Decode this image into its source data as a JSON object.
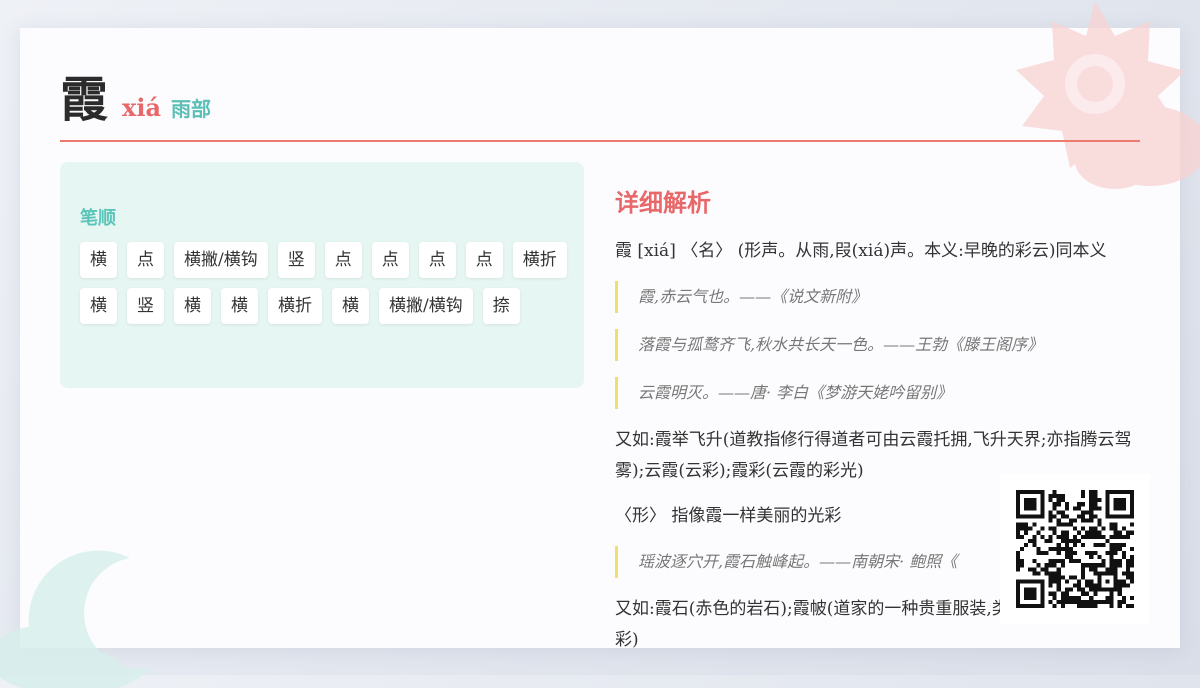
{
  "header": {
    "character": "霞",
    "pinyin": "xiá",
    "radical": "雨部"
  },
  "stroke_order": {
    "title": "笔顺",
    "strokes": [
      "横",
      "点",
      "横撇/横钩",
      "竖",
      "点",
      "点",
      "点",
      "点",
      "横折",
      "横",
      "竖",
      "横",
      "横",
      "横折",
      "横",
      "横撇/横钩",
      "捺"
    ]
  },
  "detail": {
    "title": "详细解析",
    "definition_1": "霞 [xiá] 〈名〉 (形声。从雨,叚(xiá)声。本义:早晚的彩云)同本义",
    "quotes_1": [
      "霞,赤云气也。——《说文新附》",
      "落霞与孤鹜齐飞,秋水共长天一色。——王勃《滕王阁序》",
      "云霞明灭。——唐· 李白《梦游天姥吟留别》"
    ],
    "example_1": "又如:霞举飞升(道教指修行得道者可由云霞托拥,飞升天界;亦指腾云驾雾);云霞(云彩);霞彩(云霞的彩光)",
    "definition_2": "〈形〉 指像霞一样美丽的光彩",
    "quotes_2": [
      "瑶波逐穴开,霞石触峰起。——南朝宋· 鲍照《"
    ],
    "example_2": "又如:霞石(赤色的岩石);霞帔(道家的一种贵重服装,类似披肩,文有霞彩)"
  },
  "colors": {
    "accent_red": "#e8686a",
    "accent_teal": "#5bc4b8",
    "quote_bar": "#f2de6e"
  },
  "icons": [
    "sun-cloud-decoration-icon",
    "moon-cloud-decoration-icon",
    "qr-code-icon"
  ]
}
